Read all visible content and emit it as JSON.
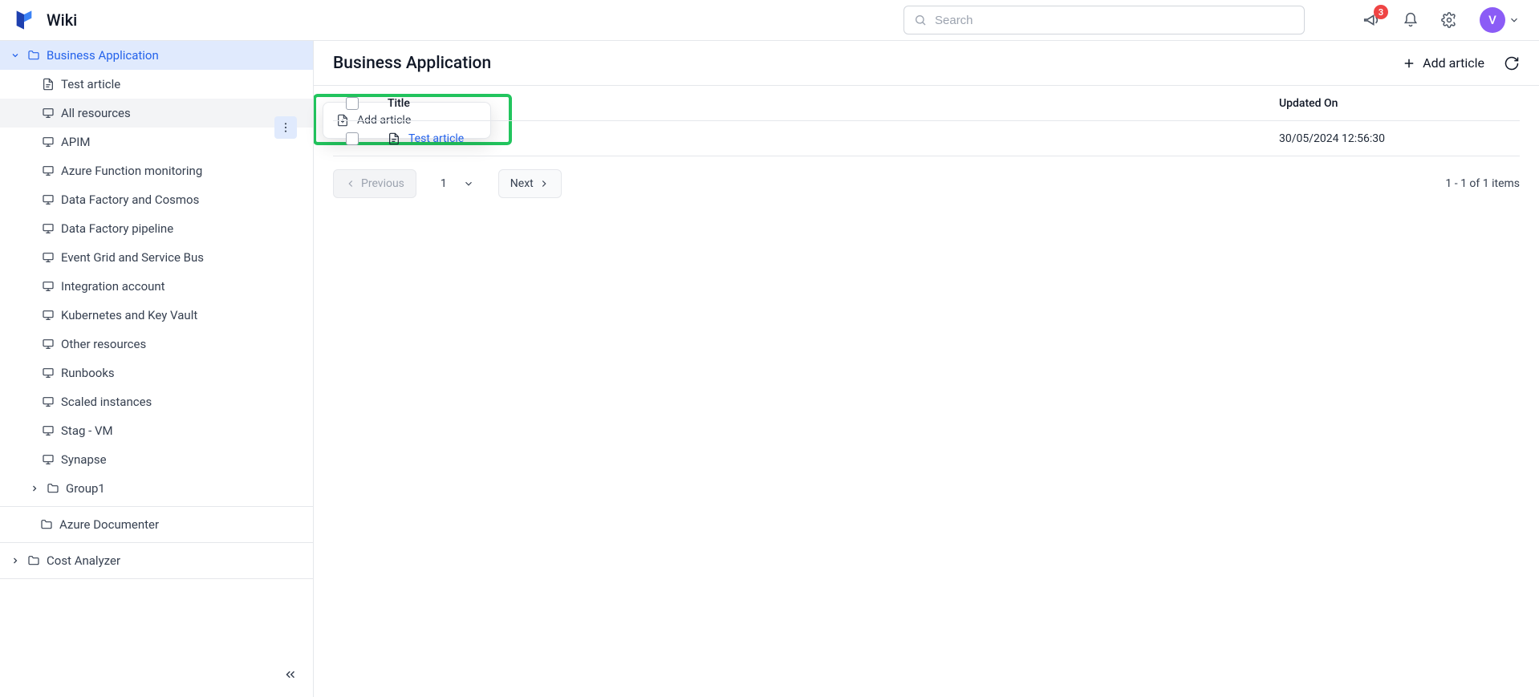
{
  "header": {
    "app_title": "Wiki",
    "search_placeholder": "Search",
    "notification_count": "3",
    "avatar_initial": "V"
  },
  "sidebar": {
    "root": {
      "label": "Business Application"
    },
    "items": [
      {
        "label": "Test article",
        "type": "article"
      },
      {
        "label": "All resources",
        "type": "monitor"
      },
      {
        "label": "APIM",
        "type": "monitor"
      },
      {
        "label": "Azure Function monitoring",
        "type": "monitor"
      },
      {
        "label": "Data Factory and Cosmos",
        "type": "monitor"
      },
      {
        "label": "Data Factory pipeline",
        "type": "monitor"
      },
      {
        "label": "Event Grid and Service Bus",
        "type": "monitor"
      },
      {
        "label": "Integration account",
        "type": "monitor"
      },
      {
        "label": "Kubernetes and Key Vault",
        "type": "monitor"
      },
      {
        "label": "Other resources",
        "type": "monitor"
      },
      {
        "label": "Runbooks",
        "type": "monitor"
      },
      {
        "label": "Scaled instances",
        "type": "monitor"
      },
      {
        "label": "Stag - VM",
        "type": "monitor"
      },
      {
        "label": "Synapse",
        "type": "monitor"
      }
    ],
    "subfolder": {
      "label": "Group1"
    },
    "extra_folders": [
      {
        "label": "Azure Documenter"
      },
      {
        "label": "Cost Analyzer"
      }
    ]
  },
  "context_menu": {
    "add_article": "Add article"
  },
  "main": {
    "title": "Business Application",
    "add_article_label": "Add article",
    "columns": {
      "title": "Title",
      "updated": "Updated On"
    },
    "rows": [
      {
        "title": "Test article",
        "updated": "30/05/2024 12:56:30"
      }
    ],
    "pager": {
      "prev": "Previous",
      "next": "Next",
      "page": "1",
      "info": "1 - 1 of 1 items"
    }
  }
}
